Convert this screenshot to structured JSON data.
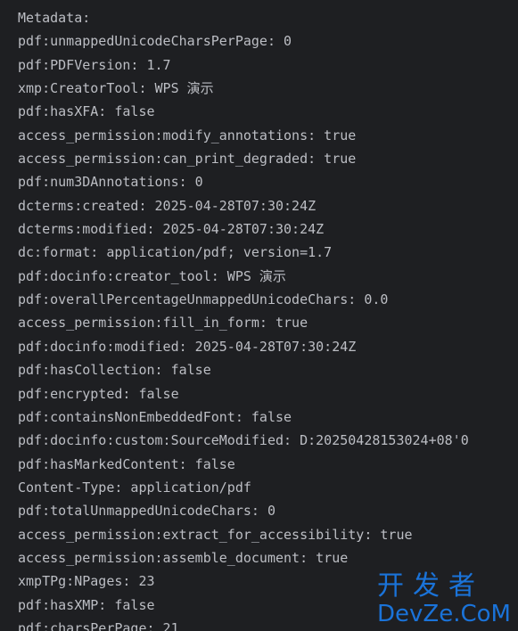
{
  "console": {
    "lines": [
      "Metadata:",
      "pdf:unmappedUnicodeCharsPerPage: 0",
      "pdf:PDFVersion: 1.7",
      "xmp:CreatorTool: WPS 演示",
      "pdf:hasXFA: false",
      "access_permission:modify_annotations: true",
      "access_permission:can_print_degraded: true",
      "pdf:num3DAnnotations: 0",
      "dcterms:created: 2025-04-28T07:30:24Z",
      "dcterms:modified: 2025-04-28T07:30:24Z",
      "dc:format: application/pdf; version=1.7",
      "pdf:docinfo:creator_tool: WPS 演示",
      "pdf:overallPercentageUnmappedUnicodeChars: 0.0",
      "access_permission:fill_in_form: true",
      "pdf:docinfo:modified: 2025-04-28T07:30:24Z",
      "pdf:hasCollection: false",
      "pdf:encrypted: false",
      "pdf:containsNonEmbeddedFont: false",
      "pdf:docinfo:custom:SourceModified: D:20250428153024+08'0",
      "pdf:hasMarkedContent: false",
      "Content-Type: application/pdf",
      "pdf:totalUnmappedUnicodeChars: 0",
      "access_permission:extract_for_accessibility: true",
      "access_permission:assemble_document: true",
      "xmpTPg:NPages: 23",
      "pdf:hasXMP: false",
      "pdf:charsPerPage: 21"
    ]
  },
  "watermark": {
    "cn": "开发者",
    "en": "DevZe.CoM"
  },
  "colors": {
    "background": "#1e1f22",
    "text": "#bcbec4",
    "watermark": "#1a73d9"
  }
}
